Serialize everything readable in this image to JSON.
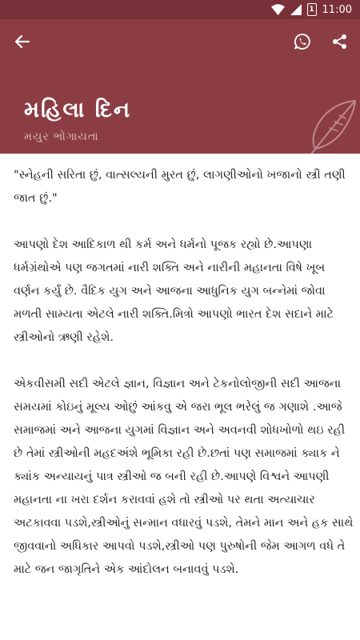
{
  "status_bar": {
    "time": "11:00",
    "battery_level": "1"
  },
  "toolbar": {
    "back_icon": "arrow-left-icon",
    "whatsapp_icon": "whatsapp-icon",
    "share_icon": "share-icon"
  },
  "article": {
    "title": "મહિલા દિન",
    "author": "મયુર ભોગાયતા",
    "paragraphs": [
      "\"સ્નેહની સરિતા છું, વાત્સલ્યની મુરત છું, લાગણીઓનો ખજાનો સ્ત્રી તણી જાત છું.\"",
      "આપણો દેશ આદિકાળ થી કર્મ અને ધર્મનો પૂજક રહ્યો છે.આપણા ધર્મગ્રંથોએ પણ જગતમાં નારી શક્તિ અને નારીની મહાનતા વિષે ખૂબ વર્ણન કર્યું છે. વૈદિક યુગ અને આજના આધુનિક યુગ બન્નેમાં જોવા મળતી સામ્યતા એટલે નારી શક્તિ.મિત્રો આપણો ભારત દેશ સદાને માટે સ્ત્રીઓનો ઋણી રહેશે.",
      "એકવીસમી સદી એટલે જ્ઞાન, વિજ્ઞાન અને ટેકનોલોજીની સદી આજના સમયમાં કોઇનું મૂલ્ય ઓછું આંકવુ એ જરા ભૂલ ભરેલું જ ગણાશે .આજે સમાજમાં અને આજના યુગમાં વિજ્ઞાન અને અવનવી શોધખોળો થઇ રહી છે તેમાં સ્ત્રીઓની મહદઅંશે ભૂમિકા રહી છે.છતાં પણ સમાજમાં ક્યાક ને ક્યાંક અન્યાયનું પાત્ર સ્ત્રીઓ જ બની રહી છે.આપણે વિશ્વને આપણી મહાનતા ના ખરા દર્શન કરાવવાં હશે તો સ્ત્રીઓ પર થતા અત્યાચાર અટકાવવા પડશે,સ્ત્રીઓનું સન્માન વધારવું પડશે, તેમને માન અને હક સાથે જીવવાનો અધિકાર આપવો પડશે,સ્ત્રીઓ પણ પુરુષોની જેમ આગળ વધે તે માટે જન જાગૃતિને એક આંદોલન બનાવવું પડશે."
    ]
  },
  "colors": {
    "status_bar": "#7a3038",
    "header": "#8c3d44",
    "author_text": "#d9b6b9",
    "body_text": "#222222"
  }
}
